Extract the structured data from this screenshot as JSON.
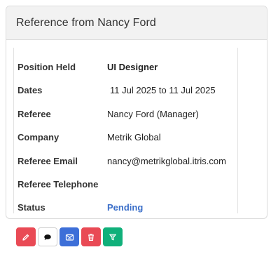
{
  "card": {
    "title": "Reference from Nancy Ford"
  },
  "details": [
    {
      "label": "Position Held",
      "value": "UI Designer"
    },
    {
      "label": "Dates",
      "value": "11 Jul 2025 to 11 Jul 2025"
    },
    {
      "label": "Referee",
      "value": "Nancy Ford (Manager)"
    },
    {
      "label": "Company",
      "value": "Metrik Global"
    },
    {
      "label": "Referee Email",
      "value": "nancy@metrikglobal.itris.com"
    },
    {
      "label": "Referee Telephone",
      "value": ""
    },
    {
      "label": "Status",
      "value": "Pending"
    }
  ],
  "actions": [
    {
      "icon": "pencil-icon",
      "color": "#e94a55"
    },
    {
      "icon": "comment-icon",
      "color": "#ffffff"
    },
    {
      "icon": "mail-icon",
      "color": "#3d6fd8"
    },
    {
      "icon": "trash-icon",
      "color": "#e94a55"
    },
    {
      "icon": "filter-icon",
      "color": "#10b07a"
    }
  ],
  "colors": {
    "status_pending": "#3b6fc9",
    "header_bg": "#f2f2f2"
  }
}
